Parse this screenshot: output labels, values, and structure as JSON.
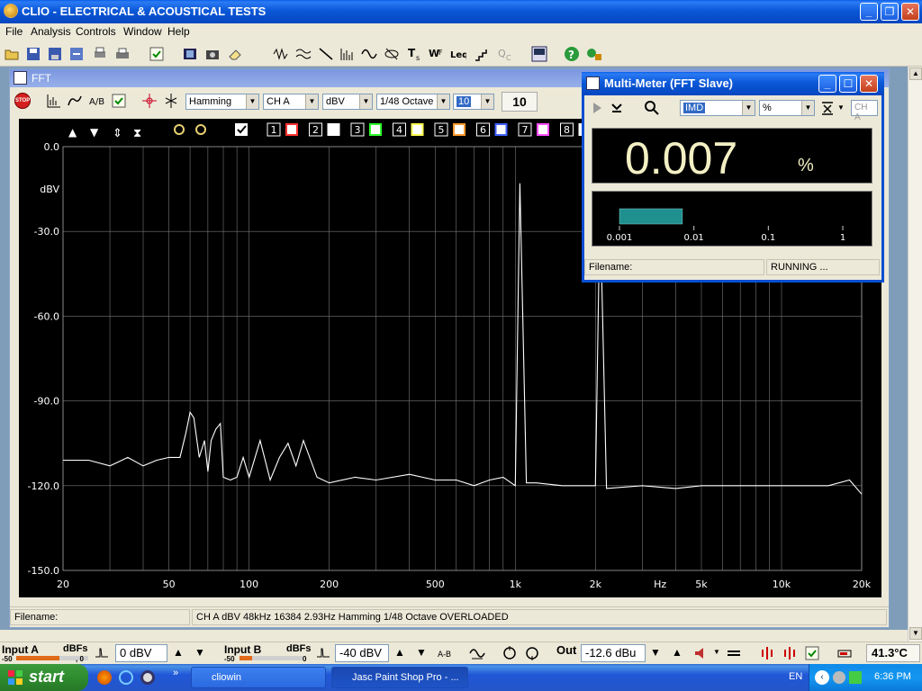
{
  "app": {
    "title": "CLIO - ELECTRICAL & ACOUSTICAL TESTS",
    "menu": [
      "File",
      "Analysis",
      "Controls",
      "Window",
      "Help"
    ]
  },
  "fft_window": {
    "title": "FFT",
    "window_type": "Hamming",
    "channel": "CH A",
    "unit": "dBV",
    "smoothing": "1/48 Octave",
    "averages_select": "10",
    "averages_display": "10",
    "stop_label": "STOP",
    "memory_labels": [
      "1",
      "2",
      "3",
      "4",
      "5",
      "6",
      "7",
      "8"
    ],
    "status": {
      "filename_label": "Filename:",
      "info": "CH A   dBV   48kHz   16384   2.93Hz   Hamming   1/48 Octave   OVERLOADED"
    }
  },
  "chart_data": {
    "type": "line",
    "title": "",
    "xlabel": "Hz",
    "ylabel": "dBV",
    "x_scale": "log",
    "xlim": [
      20,
      20000
    ],
    "ylim": [
      -150,
      0
    ],
    "x_ticks": [
      "20",
      "50",
      "100",
      "200",
      "500",
      "1k",
      "2k",
      "Hz",
      "5k",
      "10k",
      "20k"
    ],
    "y_ticks": [
      "0.0",
      "dBV",
      "-30.0",
      "-60.0",
      "-90.0",
      "-120.0",
      "-150.0"
    ],
    "grid": true,
    "series": [
      {
        "color": "#ffffff",
        "x": [
          20,
          25,
          30,
          35,
          40,
          45,
          50,
          55,
          58,
          60,
          62,
          65,
          68,
          70,
          72,
          75,
          78,
          80,
          85,
          90,
          95,
          100,
          110,
          120,
          130,
          140,
          150,
          160,
          180,
          200,
          250,
          300,
          400,
          500,
          600,
          700,
          800,
          900,
          1000,
          1040,
          1100,
          1200,
          1500,
          2000,
          2080,
          2200,
          3000,
          4000,
          5000,
          6000,
          8000,
          10000,
          15000,
          18000,
          20000
        ],
        "y": [
          -111,
          -111,
          -113,
          -110,
          -113,
          -111,
          -110,
          -110,
          -101,
          -94,
          -96,
          -110,
          -104,
          -115,
          -104,
          -100,
          -98,
          -117,
          -118,
          -117,
          -110,
          -117,
          -104,
          -118,
          -110,
          -105,
          -113,
          -104,
          -117,
          -119,
          -117,
          -118,
          -116,
          -118,
          -118,
          -120,
          -118,
          -117,
          -120,
          -13,
          -119,
          -119,
          -120,
          -120,
          -20,
          -121,
          -120,
          -121,
          -120,
          -120,
          -120,
          -120,
          -120,
          -118,
          -123
        ]
      }
    ]
  },
  "multimeter": {
    "title": "Multi-Meter (FFT Slave)",
    "parameter": "IMD",
    "unit_select": "%",
    "channel": "CH A",
    "value": "0.007",
    "unit": "%",
    "bar_value": 0.007,
    "bar_scale": [
      "0.001",
      "0.01",
      "0.1",
      "1"
    ],
    "filename_label": "Filename:",
    "status": "RUNNING ..."
  },
  "bottom": {
    "input_a_label": "Input A",
    "input_b_label": "Input B",
    "dbfs_label": "dBFs",
    "scale_left": "-50",
    "scale_right": ", 0",
    "scale_right_b": "0",
    "input_a_value": "0 dBV",
    "input_b_value": "-40 dBV",
    "out_label": "Out",
    "out_value": "-12.6 dBu",
    "temperature": "41.3°C"
  },
  "taskbar": {
    "start": "start",
    "tasks": [
      "cliowin",
      "Jasc Paint Shop Pro - ..."
    ],
    "language": "EN",
    "clock": "6:36 PM"
  },
  "colors": {
    "xp_blue": "#0a5ee8",
    "plot_bg": "#000000",
    "grid": "#777777",
    "trace": "#ffffff",
    "mm_bar": "#1f8f8f"
  }
}
